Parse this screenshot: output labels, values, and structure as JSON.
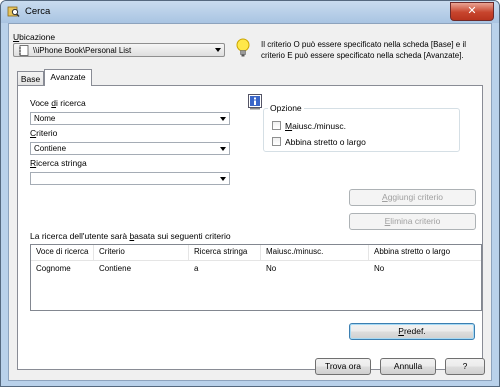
{
  "window": {
    "title": "Cerca",
    "close_glyph": "✕"
  },
  "location": {
    "label": "Ubicazione",
    "value": "\\\\iPhone Book\\Personal List",
    "hint": "Il criterio O può essere specificato nella scheda [Base] e il criterio E può essere specificato nella scheda [Avanzate]."
  },
  "tabs": [
    {
      "label": "Base",
      "active": false
    },
    {
      "label": "Avanzate",
      "active": true
    }
  ],
  "search_field": {
    "label": "Voce di ricerca",
    "value": "Nome"
  },
  "criteria": {
    "label": "Criterio",
    "value": "Contiene"
  },
  "search_string": {
    "label": "Ricerca stringa",
    "value": ""
  },
  "options": {
    "label": "Opzione",
    "case_sensitive": {
      "label": "Maiusc./minusc.",
      "checked": false
    },
    "match_strict": {
      "label": "Abbina stretto o largo",
      "checked": false
    }
  },
  "buttons": {
    "add_criteria": "Aggiungi criterio",
    "delete_criteria": "Elimina criterio",
    "default": "Predef.",
    "search_now": "Trova ora",
    "cancel": "Annulla",
    "help": "?"
  },
  "criteria_list": {
    "caption": "La ricerca dell'utente sarà basata sui seguenti criterio",
    "columns": [
      "Voce di ricerca",
      "Criterio",
      "Ricerca stringa",
      "Maiusc./minusc.",
      "Abbina stretto o largo"
    ],
    "rows": [
      [
        "Cognome",
        "Contiene",
        "a",
        "No",
        "No"
      ]
    ]
  },
  "icons": {
    "title": "search-window-icon",
    "location": "address-book-icon",
    "hint": "lightbulb-icon",
    "info": "info-icon"
  },
  "colors": {
    "title_bg": "#b9d1ea",
    "client_bg": "#f0f0f0",
    "close": "#c7442d",
    "default_btn_border": "#3c7fb1"
  }
}
